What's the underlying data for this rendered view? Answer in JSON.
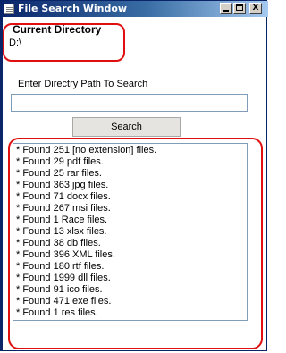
{
  "window": {
    "title": "File Search Window",
    "controls": {
      "minimize": "_",
      "maximize": "□",
      "close": "X"
    }
  },
  "current_directory": {
    "label": "Current Directory",
    "value": "D:\\"
  },
  "search": {
    "path_label": "Enter Directry Path To Search",
    "path_value": "",
    "button_label": "Search"
  },
  "results": [
    "* Found 251 [no extension] files.",
    "* Found 29 pdf files.",
    "* Found 25 rar files.",
    "* Found 363 jpg files.",
    "* Found 71 docx files.",
    "* Found 267 msi files.",
    "* Found 1 Race files.",
    "* Found 13 xlsx files.",
    "* Found 38 db files.",
    "* Found 396 XML files.",
    "* Found 180 rtf files.",
    "* Found 1999 dll files.",
    "* Found 91 ico files.",
    "* Found 471 exe files.",
    "* Found 1 res files."
  ],
  "colors": {
    "annotation": "#e01010",
    "titlebar": "#0a246a"
  }
}
